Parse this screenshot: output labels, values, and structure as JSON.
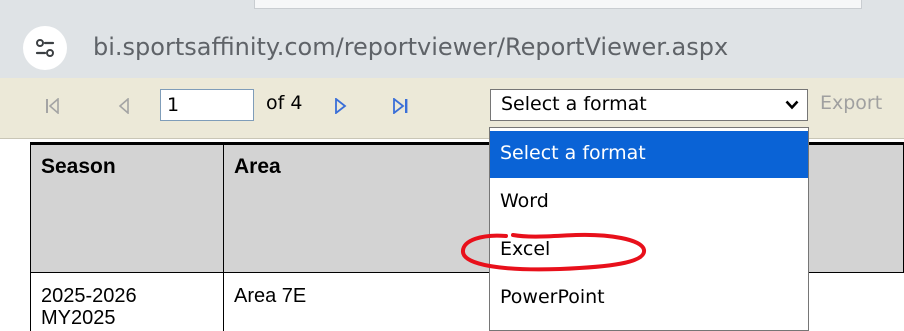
{
  "browser": {
    "url": "bi.sportsaffinity.com/reportviewer/ReportViewer.aspx"
  },
  "toolbar": {
    "page_input_value": "1",
    "page_of_label": "of 4",
    "format_select_value": "Select a format",
    "export_label": "Export"
  },
  "report": {
    "columns": [
      "Season",
      "Area"
    ],
    "rows": [
      [
        "2025-2026\nMY2025",
        "Area 7E"
      ]
    ]
  },
  "format_dropdown": {
    "options": [
      "Select a format",
      "Word",
      "Excel",
      "PowerPoint"
    ],
    "highlighted_index": 0
  },
  "colors": {
    "toolbar_bg": "#ece9d8",
    "address_bar_bg": "#dfe3e6",
    "dropdown_highlight": "#0a63d6",
    "nav_arrow_active": "#3a6fd8",
    "annotation_red": "#e8101b"
  }
}
